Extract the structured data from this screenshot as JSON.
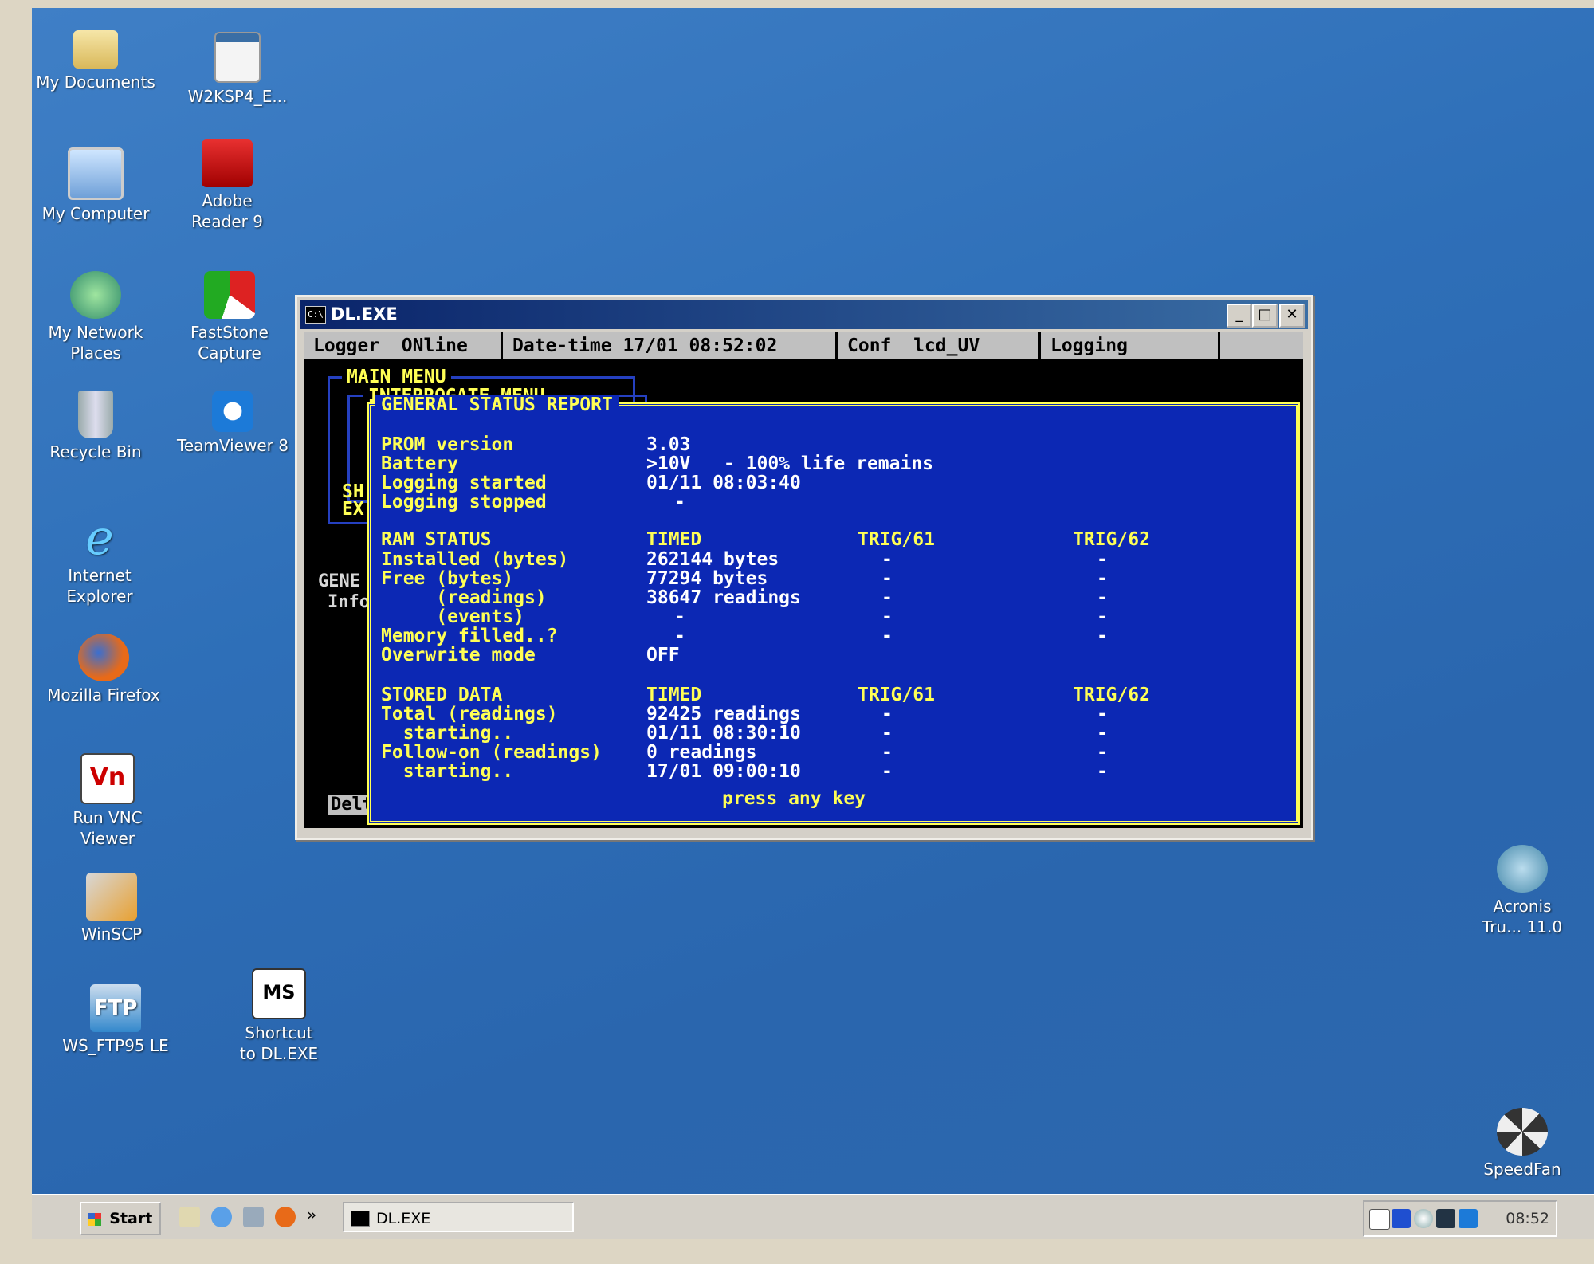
{
  "desktop": {
    "icons": [
      {
        "label": "My Documents",
        "icon": "folder-icon"
      },
      {
        "label": "W2KSP4_E...",
        "icon": "window-icon"
      },
      {
        "label": "My Computer",
        "icon": "computer-icon"
      },
      {
        "label": "Adobe Reader 9",
        "icon": "pdf-icon"
      },
      {
        "label": "My Network Places",
        "icon": "network-icon"
      },
      {
        "label": "FastStone Capture",
        "icon": "capture-icon"
      },
      {
        "label": "Recycle Bin",
        "icon": "recycle-bin-icon"
      },
      {
        "label": "TeamViewer 8",
        "icon": "teamviewer-icon"
      },
      {
        "label": "Internet Explorer",
        "icon": "ie-icon"
      },
      {
        "label": "Mozilla Firefox",
        "icon": "firefox-icon"
      },
      {
        "label": "Run VNC Viewer",
        "icon": "vnc-icon"
      },
      {
        "label": "WinSCP",
        "icon": "winscp-icon"
      },
      {
        "label": "WS_FTP95 LE",
        "icon": "ftp-icon"
      },
      {
        "label": "Shortcut to DL.EXE",
        "icon": "ms-dos-icon"
      },
      {
        "label": "Acronis Tru... 11.0",
        "icon": "acronis-icon"
      },
      {
        "label": "SpeedFan",
        "icon": "fan-icon"
      }
    ]
  },
  "window": {
    "title": "DL.EXE",
    "title_icon": "C:\\",
    "buttons": {
      "minimize": "_",
      "maximize": "□",
      "close": "✕"
    }
  },
  "console": {
    "status": {
      "logger": "Logger  ONline",
      "datetime": "Date-time 17/01 08:52:02",
      "conf": "Conf  lcd_UV",
      "logging": "Logging"
    },
    "menus": {
      "main": "MAIN MENU",
      "interrogate": "INTERROGATE MENU",
      "report_title": "GENERAL STATUS REPORT",
      "partial_sh": "SH",
      "partial_ex": "EX",
      "partial_gene": "GENE",
      "partial_info": "Info",
      "partial_delt": "Delt"
    },
    "report": {
      "prom_label": "PROM version",
      "prom_value": "3.03",
      "battery_label": "Battery",
      "battery_value": ">10V   - 100% life remains",
      "log_started_label": "Logging started",
      "log_started_value": "01/11 08:03:40",
      "log_stopped_label": "Logging stopped",
      "log_stopped_value": "-",
      "ram": {
        "heading": "RAM STATUS",
        "columns": [
          "TIMED",
          "TRIG/61",
          "TRIG/62"
        ],
        "rows": [
          {
            "label": "Installed (bytes)",
            "values": [
              "262144 bytes",
              "-",
              "-"
            ]
          },
          {
            "label": "Free (bytes)",
            "values": [
              "77294 bytes",
              "-",
              "-"
            ]
          },
          {
            "label": "     (readings)",
            "values": [
              "38647 readings",
              "-",
              "-"
            ]
          },
          {
            "label": "     (events)",
            "values": [
              "-",
              "-",
              "-"
            ]
          },
          {
            "label": "Memory filled..?",
            "values": [
              "-",
              "-",
              "-"
            ]
          },
          {
            "label": "Overwrite mode",
            "values": [
              "OFF",
              "",
              ""
            ]
          }
        ]
      },
      "stored": {
        "heading": "STORED DATA",
        "columns": [
          "TIMED",
          "TRIG/61",
          "TRIG/62"
        ],
        "rows": [
          {
            "label": "Total (readings)",
            "values": [
              "92425 readings",
              "-",
              "-"
            ]
          },
          {
            "label": "  starting..",
            "values": [
              "01/11 08:30:10",
              "-",
              "-"
            ]
          },
          {
            "label": "Follow-on (readings)",
            "values": [
              "0 readings",
              "-",
              "-"
            ]
          },
          {
            "label": "  starting..",
            "values": [
              "17/01 09:00:10",
              "-",
              "-"
            ]
          }
        ]
      },
      "footer": "press any key"
    }
  },
  "taskbar": {
    "start_label": "Start",
    "task_label": "DL.EXE",
    "more": "»",
    "clock": "08:52",
    "tray_icons": [
      "vnc-tray-icon",
      "network-tray-icon",
      "speaker-tray-icon",
      "pen-tray-icon",
      "teamviewer-tray-icon"
    ]
  },
  "colors": {
    "desktop": "#2e6fb8",
    "console_bg": "#0c28b4",
    "console_text": "#ffff55",
    "value_text": "#ffffff"
  }
}
